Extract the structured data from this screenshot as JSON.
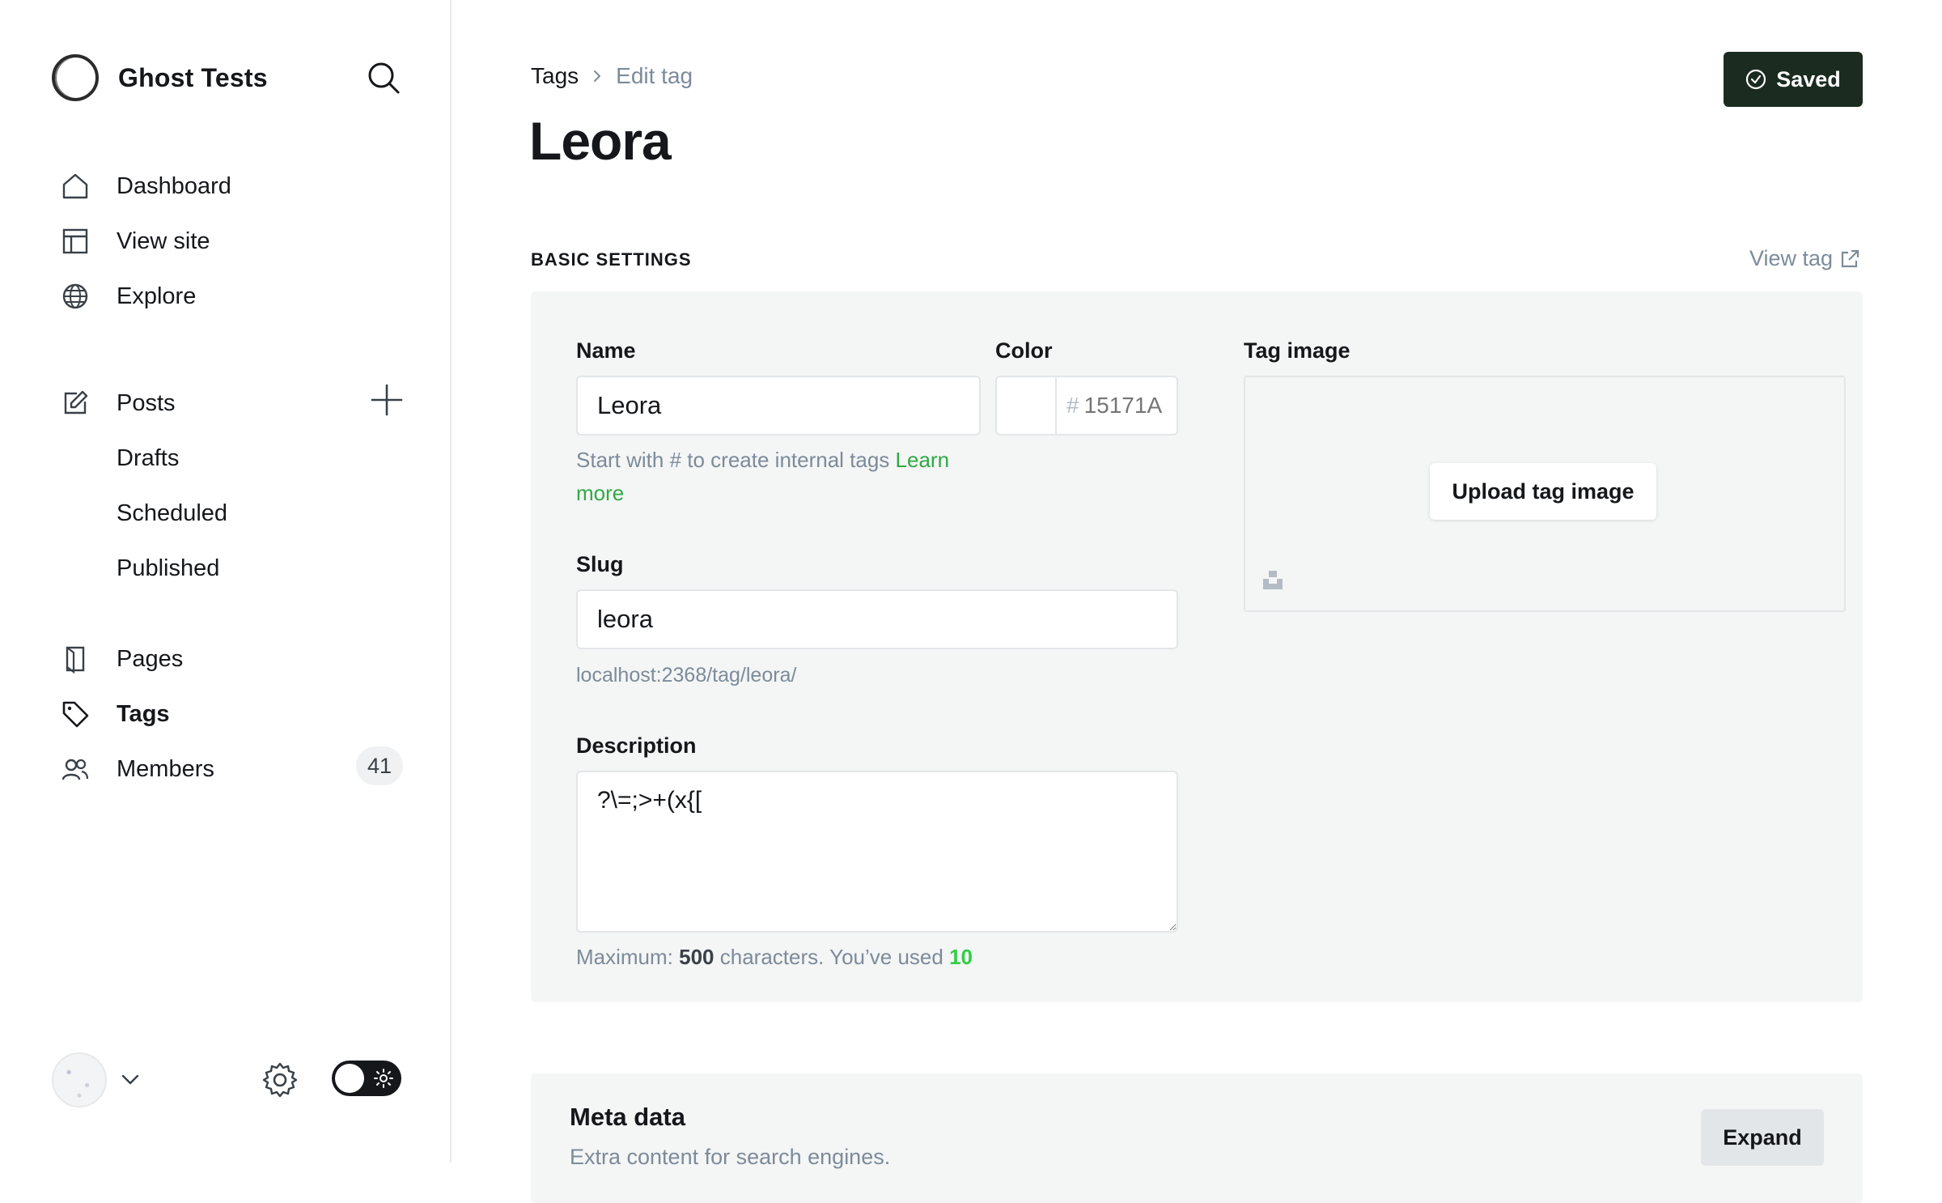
{
  "sidebar": {
    "brand": "Ghost Tests",
    "nav": {
      "dashboard": "Dashboard",
      "view_site": "View site",
      "explore": "Explore",
      "posts": "Posts",
      "drafts": "Drafts",
      "scheduled": "Scheduled",
      "published": "Published",
      "pages": "Pages",
      "tags": "Tags",
      "members": "Members",
      "members_count": "41"
    },
    "active_item": "Tags"
  },
  "header": {
    "breadcrumb_parent": "Tags",
    "breadcrumb_current": "Edit tag",
    "title": "Leora",
    "saved_label": "Saved"
  },
  "basic_settings": {
    "section_label": "BASIC SETTINGS",
    "view_tag_label": "View tag",
    "name_label": "Name",
    "name_value": "Leora",
    "name_hint": "Start with # to create internal tags",
    "learn_more": "Learn more",
    "color_label": "Color",
    "color_hash": "#",
    "color_placeholder": "15171A",
    "slug_label": "Slug",
    "slug_value": "leora",
    "slug_url": "localhost:2368/tag/leora/",
    "description_label": "Description",
    "description_value": "?\\=;>+(x{[",
    "desc_max_prefix": "Maximum:",
    "desc_max": "500",
    "desc_mid": "characters. You’ve used",
    "desc_used": "10",
    "tag_image_label": "Tag image",
    "upload_label": "Upload tag image"
  },
  "meta_data": {
    "title": "Meta data",
    "subtitle": "Extra content for search engines.",
    "expand_label": "Expand"
  },
  "colors": {
    "accent_green": "#30cf43",
    "saved_button_bg": "#1b2b20",
    "panel_bg": "#f4f5f5"
  }
}
